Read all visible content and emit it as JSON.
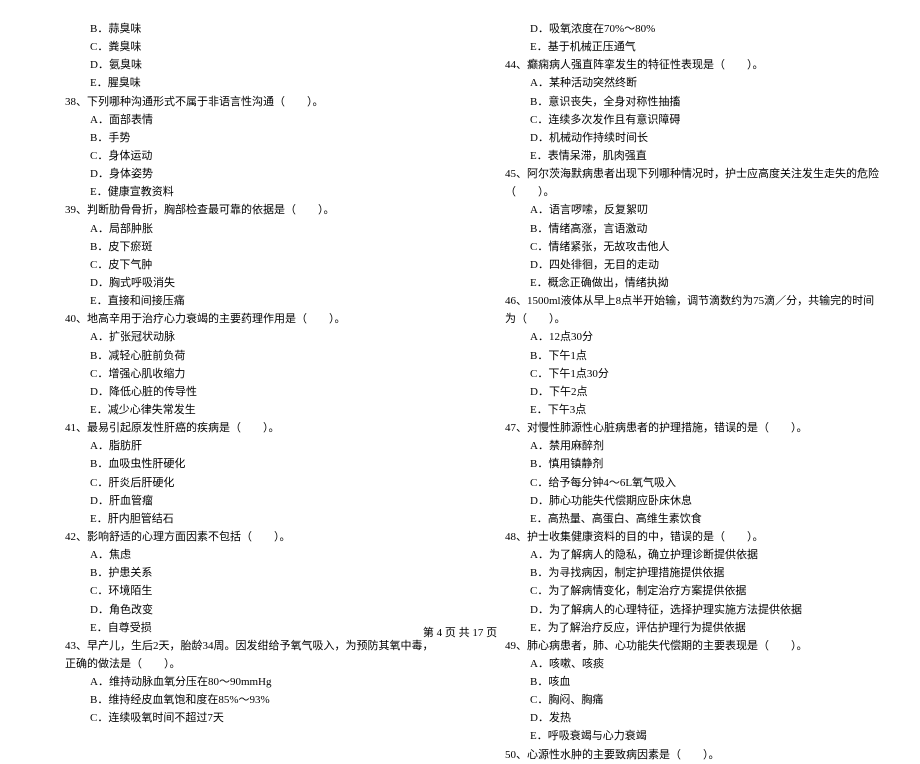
{
  "left": {
    "opts_pre": [
      "B．蒜臭味",
      "C．粪臭味",
      "D．氨臭味",
      "E．腥臭味"
    ],
    "q38": "38、下列哪种沟通形式不属于非语言性沟通（　　）。",
    "q38_opts": [
      "A．面部表情",
      "B．手势",
      "C．身体运动",
      "D．身体姿势",
      "E．健康宣教资料"
    ],
    "q39": "39、判断肋骨骨折，胸部检查最可靠的依据是（　　）。",
    "q39_opts": [
      "A．局部肿胀",
      "B．皮下瘀斑",
      "C．皮下气肿",
      "D．胸式呼吸消失",
      "E．直接和间接压痛"
    ],
    "q40": "40、地高辛用于治疗心力衰竭的主要药理作用是（　　）。",
    "q40_opts": [
      "A．扩张冠状动脉",
      "B．减轻心脏前负荷",
      "C．增强心肌收缩力",
      "D．降低心脏的传导性",
      "E．减少心律失常发生"
    ],
    "q41": "41、最易引起原发性肝癌的疾病是（　　）。",
    "q41_opts": [
      "A．脂肪肝",
      "B．血吸虫性肝硬化",
      "C．肝炎后肝硬化",
      "D．肝血管瘤",
      "E．肝内胆管结石"
    ],
    "q42": "42、影响舒适的心理方面因素不包括（　　）。",
    "q42_opts": [
      "A．焦虑",
      "B．护患关系",
      "C．环境陌生",
      "D．角色改变",
      "E．自尊受损"
    ],
    "q43": "43、早产儿，生后2天，胎龄34周。因发绀给予氧气吸入，为预防其氧中毒，正确的做法是（　　）。",
    "q43_opts": [
      "A．维持动脉血氧分压在80～90mmHg",
      "B．维持经皮血氧饱和度在85%～93%",
      "C．连续吸氧时间不超过7天"
    ]
  },
  "right": {
    "opts_pre": [
      "D．吸氧浓度在70%～80%",
      "E．基于机械正压通气"
    ],
    "q44": "44、癫痫病人强直阵挛发生的特征性表现是（　　）。",
    "q44_opts": [
      "A．某种活动突然终断",
      "B．意识丧失，全身对称性抽搐",
      "C．连续多次发作且有意识障碍",
      "D．机械动作持续时间长",
      "E．表情呆滞，肌肉强直"
    ],
    "q45": "45、阿尔茨海默病患者出现下列哪种情况时，护士应高度关注发生走失的危险（　　）。",
    "q45_opts": [
      "A．语言啰嗦，反复絮叨",
      "B．情绪高涨，言语激动",
      "C．情绪紧张，无故攻击他人",
      "D．四处徘徊，无目的走动",
      "E．概念正确做出，情绪执拗"
    ],
    "q46": "46、1500ml液体从早上8点半开始输，调节滴数约为75滴／分，共输完的时间为（　　）。",
    "q46_opts": [
      "A．12点30分",
      "B．下午1点",
      "C．下午1点30分",
      "D．下午2点",
      "E．下午3点"
    ],
    "q47": "47、对慢性肺源性心脏病患者的护理措施，错误的是（　　）。",
    "q47_opts": [
      "A．禁用麻醉剂",
      "B．慎用镇静剂",
      "C．给予每分钟4～6L氧气吸入",
      "D．肺心功能失代偿期应卧床休息",
      "E．高热量、高蛋白、高维生素饮食"
    ],
    "q48": "48、护士收集健康资料的目的中，错误的是（　　）。",
    "q48_opts": [
      "A．为了解病人的隐私，确立护理诊断提供依据",
      "B．为寻找病因，制定护理措施提供依据",
      "C．为了解病情变化，制定治疗方案提供依据",
      "D．为了解病人的心理特征，选择护理实施方法提供依据",
      "E．为了解治疗反应，评估护理行为提供依据"
    ],
    "q49": "49、肺心病患者，肺、心功能失代偿期的主要表现是（　　）。",
    "q49_opts": [
      "A．咳嗽、咳痰",
      "B．咳血",
      "C．胸闷、胸痛",
      "D．发热",
      "E．呼吸衰竭与心力衰竭"
    ],
    "q50": "50、心源性水肿的主要致病因素是（　　）。"
  },
  "footer": "第 4 页 共 17 页"
}
